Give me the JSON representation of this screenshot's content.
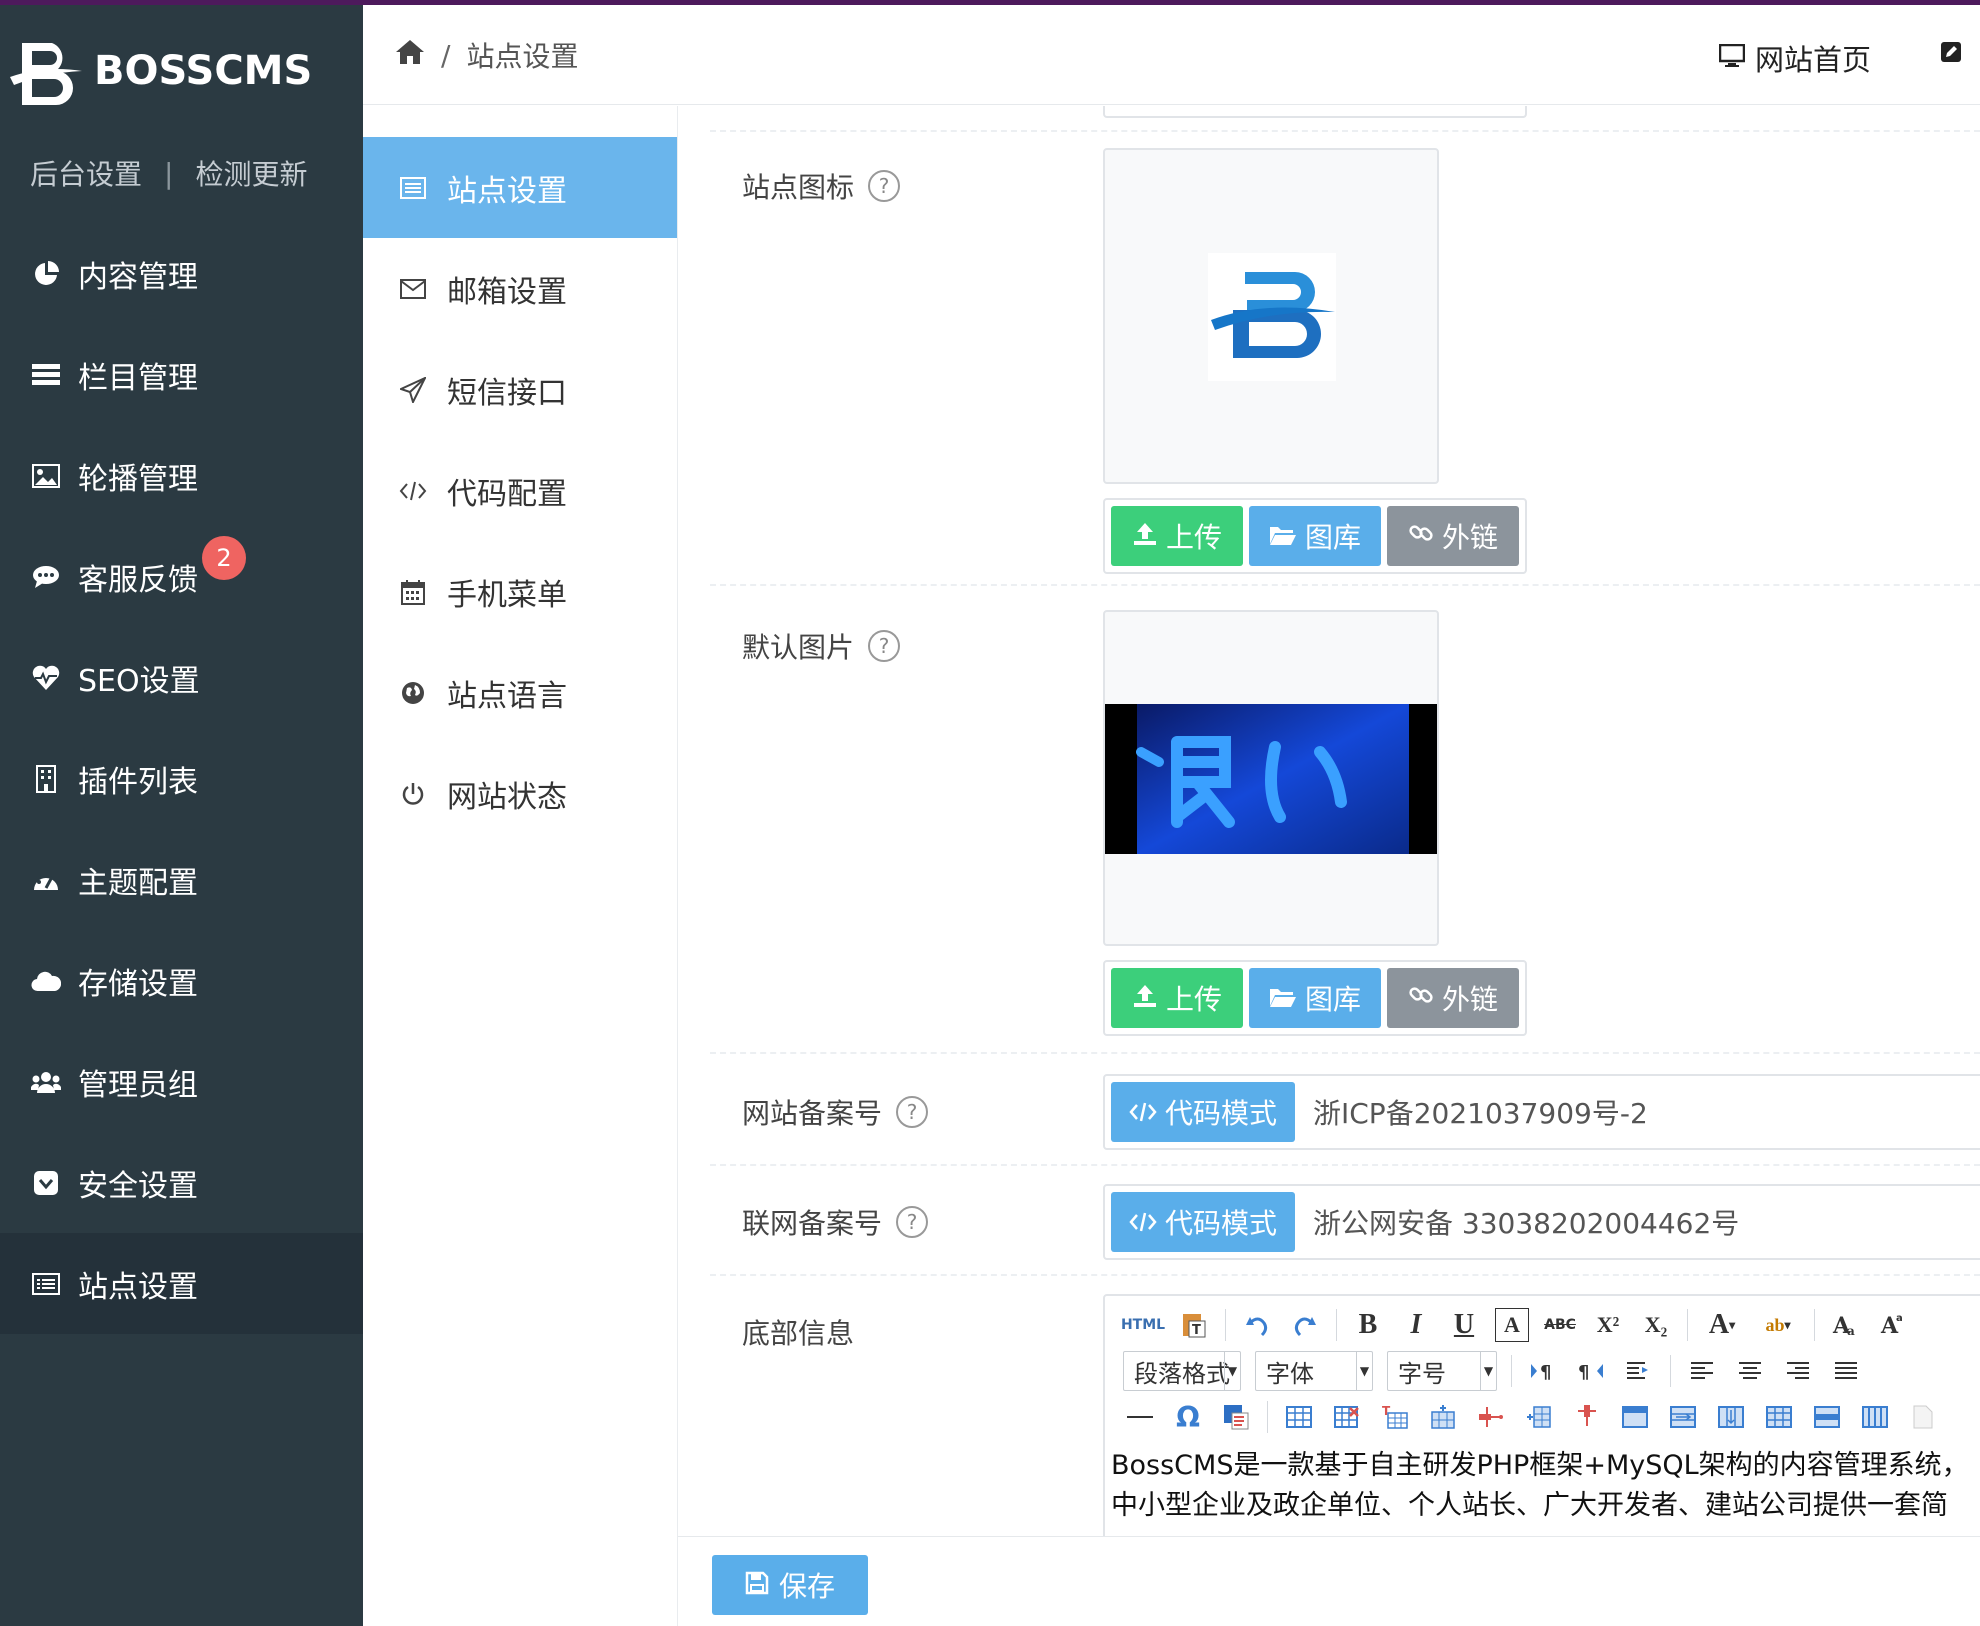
{
  "app": {
    "logo_text": "BOSSCMS"
  },
  "sidebar": {
    "links": [
      "后台设置",
      "检测更新"
    ],
    "items": [
      {
        "label": "内容管理",
        "icon": "pie-chart-icon"
      },
      {
        "label": "栏目管理",
        "icon": "list-icon"
      },
      {
        "label": "轮播管理",
        "icon": "image-icon"
      },
      {
        "label": "客服反馈",
        "icon": "chat-icon",
        "badge": "2"
      },
      {
        "label": "SEO设置",
        "icon": "heartbeat-icon"
      },
      {
        "label": "插件列表",
        "icon": "building-icon"
      },
      {
        "label": "主题配置",
        "icon": "dashboard-icon"
      },
      {
        "label": "存储设置",
        "icon": "cloud-icon"
      },
      {
        "label": "管理员组",
        "icon": "users-icon"
      },
      {
        "label": "安全设置",
        "icon": "shield-icon"
      },
      {
        "label": "站点设置",
        "icon": "settings-list-icon",
        "active": true
      }
    ]
  },
  "header": {
    "breadcrumb": "站点设置",
    "site_home": "网站首页"
  },
  "submenu": {
    "items": [
      {
        "label": "站点设置",
        "icon": "list-alt-icon",
        "active": true
      },
      {
        "label": "邮箱设置",
        "icon": "envelope-icon"
      },
      {
        "label": "短信接口",
        "icon": "paper-plane-icon"
      },
      {
        "label": "代码配置",
        "icon": "code-icon"
      },
      {
        "label": "手机菜单",
        "icon": "calendar-icon"
      },
      {
        "label": "站点语言",
        "icon": "globe-icon"
      },
      {
        "label": "网站状态",
        "icon": "power-icon"
      }
    ]
  },
  "form": {
    "site_icon": {
      "label": "站点图标",
      "help": "?"
    },
    "default_image": {
      "label": "默认图片",
      "help": "?"
    },
    "buttons": {
      "upload": "上传",
      "gallery": "图库",
      "link": "外链"
    },
    "icp": {
      "label": "网站备案号",
      "help": "?",
      "mode": "代码模式",
      "value": "浙ICP备2021037909号-2"
    },
    "police": {
      "label": "联网备案号",
      "help": "?",
      "mode": "代码模式",
      "value": "浙公网安备 33038202004462号"
    },
    "footer_info": {
      "label": "底部信息",
      "selects": [
        "段落格式",
        "字体",
        "字号"
      ],
      "toolbar_text": [
        "HTML",
        "B",
        "I",
        "U",
        "A",
        "ABC",
        "X²",
        "X₂",
        "A",
        "ab"
      ],
      "content_line1": "BossCMS是一款基于自主研发PHP框架+MySQL架构的内容管理系统，",
      "content_line2": "中小型企业及政企单位、个人站长、广大开发者、建站公司提供一套简"
    },
    "save": "保存"
  },
  "colors": {
    "sidebar_bg": "#2b3a42",
    "accent_blue": "#5aaeea",
    "green": "#3ccf7b",
    "gray": "#8c949c",
    "badge": "#ef6461"
  }
}
